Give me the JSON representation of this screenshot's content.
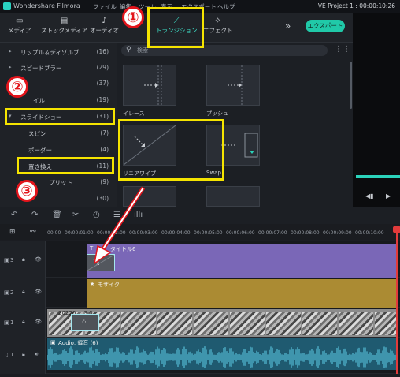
{
  "titlebar": {
    "app": "Wondershare Filmora",
    "menus": [
      "ファイル",
      "編集",
      "ツール",
      "表示",
      "エクスポート",
      "ヘルプ"
    ],
    "project": "VE Project 1 : 00:00:10:26"
  },
  "toolbar": {
    "tabs": [
      {
        "label": "メディア",
        "icon": "folder-icon"
      },
      {
        "label": "ストックメディア",
        "icon": "stock-icon"
      },
      {
        "label": "オーディオ",
        "icon": "music-note-icon"
      },
      {
        "label": "トランジション",
        "icon": "transition-icon"
      },
      {
        "label": "エフェクト",
        "icon": "effect-icon"
      }
    ],
    "more": "»",
    "export_label": "エクスポート"
  },
  "categories": [
    {
      "label": "リップル＆ディゾルブ",
      "count": "(16)",
      "arrow": "▸"
    },
    {
      "label": "スピードブラー",
      "count": "(29)",
      "arrow": "▸"
    },
    {
      "label": "",
      "count": "(37)",
      "arrow": "▸"
    },
    {
      "label": "イル",
      "count": "(19)",
      "arrow": ""
    },
    {
      "label": "スライドショー",
      "count": "(31)",
      "arrow": "▾"
    },
    {
      "label": "スピン",
      "count": "(7)",
      "arrow": ""
    },
    {
      "label": "ボーダー",
      "count": "(4)",
      "arrow": ""
    },
    {
      "label": "置き換え",
      "count": "(11)",
      "arrow": ""
    },
    {
      "label": "プリット",
      "count": "(9)",
      "arrow": ""
    },
    {
      "label": "",
      "count": "(30)",
      "arrow": ""
    }
  ],
  "search": {
    "placeholder": "検索"
  },
  "transitions": [
    {
      "label": "イレース"
    },
    {
      "label": "プッシュ"
    },
    {
      "label": "リニアワイプ"
    },
    {
      "label": "Swap"
    }
  ],
  "ruler": [
    "00:00",
    "00:00:01:00",
    "00:00:02:00",
    "00:00:03:00",
    "00:00:04:00",
    "00:00:05:00",
    "00:00:06:00",
    "00:00:07:00",
    "00:00:08:00",
    "00:00:09:00",
    "00:00:10:00"
  ],
  "tracks": {
    "t3": {
      "num": "3",
      "clip": "タイトル6"
    },
    "t2": {
      "num": "2",
      "clip": "モザイク"
    },
    "t1": {
      "num": "1",
      "clip": "20220..._3.0..."
    },
    "audio": {
      "num": "1",
      "clip": "Audio, 録音 (6)"
    }
  },
  "annotations": {
    "one": "①",
    "two": "②",
    "three": "③"
  },
  "colors": {
    "accent": "#2ad1c0",
    "highlight": "#f5e400",
    "marker": "#e3141b"
  }
}
